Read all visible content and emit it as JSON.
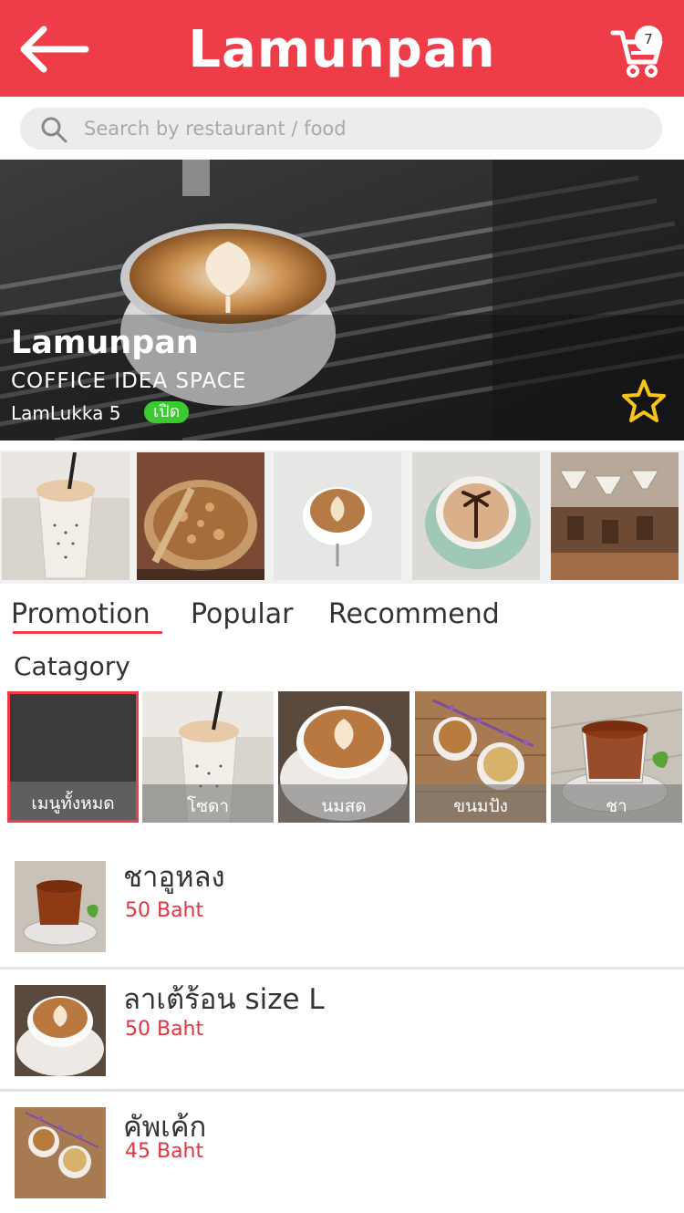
{
  "header": {
    "title": "Lamunpan",
    "back_icon": "arrow-left-icon",
    "cart_icon": "cart-icon",
    "cart_count": "7"
  },
  "search": {
    "placeholder": "Search by restaurant / food",
    "value": ""
  },
  "restaurant": {
    "name": "Lamunpan",
    "subtitle": "COFFICE IDEA SPACE",
    "location": "LamLukka 5",
    "status": "เปิด",
    "favorite_icon": "star-outline-icon"
  },
  "tabs": [
    {
      "label": "Promotion",
      "active": true
    },
    {
      "label": "Popular",
      "active": false
    },
    {
      "label": "Recommend",
      "active": false
    }
  ],
  "category_title": "Catagory",
  "categories": [
    {
      "label": "เมนูทั้งหมด",
      "selected": true
    },
    {
      "label": "โซดา",
      "selected": false
    },
    {
      "label": "นมสด",
      "selected": false
    },
    {
      "label": "ขนมปัง",
      "selected": false
    },
    {
      "label": "ชา",
      "selected": false
    }
  ],
  "menu_items": [
    {
      "name": "ชาอูหลง",
      "price": "50 Baht"
    },
    {
      "name": "ลาเต้ร้อน size L",
      "price": "50 Baht"
    },
    {
      "name": "คัพเค้ก",
      "price": "45 Baht"
    }
  ],
  "colors": {
    "brand": "#ee3c48",
    "status_open": "#3bcb31",
    "price": "#e03540",
    "star": "#f5c518"
  }
}
